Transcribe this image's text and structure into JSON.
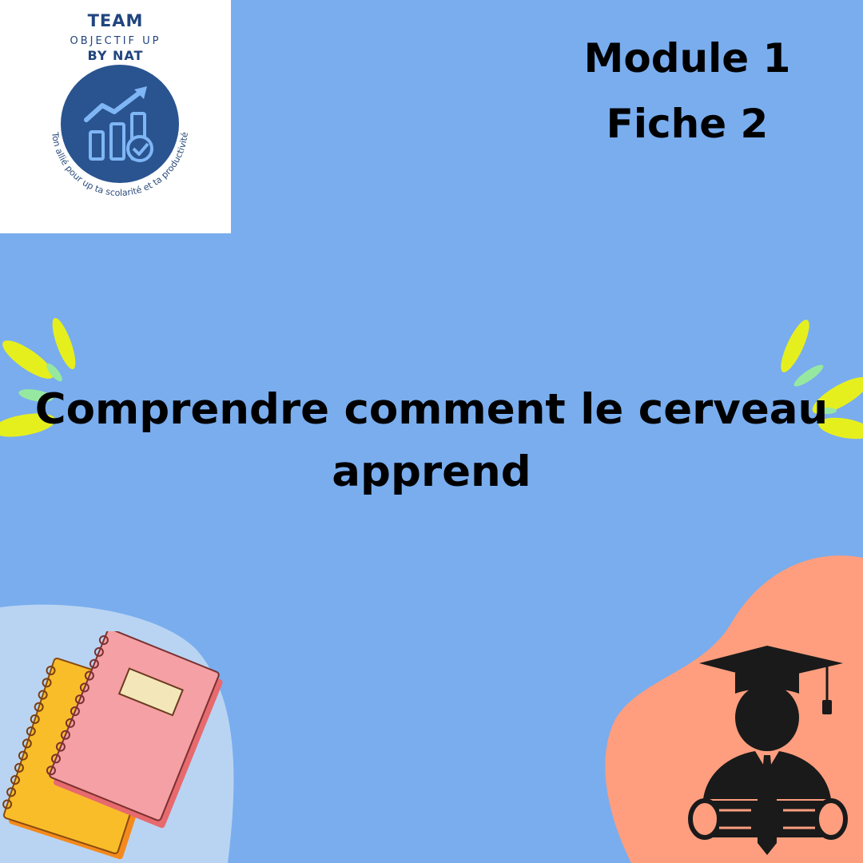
{
  "logo": {
    "line1": "TEAM",
    "line2": "OBJECTIF UP",
    "line3": "BY NAT",
    "tagline": "Ton allié pour up ta scolarité et ta productivité",
    "icon": "bar-chart-growth-check-icon",
    "brand_color": "#21457e"
  },
  "module": {
    "line1": "Module 1",
    "line2": "Fiche 2"
  },
  "title": {
    "line1": "Comprendre comment le cerveau",
    "line2": "apprend"
  },
  "illustrations": {
    "left": "notebooks-illustration",
    "right": "graduate-with-diploma-illustration",
    "accents": "yellow-green-sparkle-accents"
  },
  "colors": {
    "background": "#79adee",
    "blob_left": "#b9d4f2",
    "blob_right": "#fe9e7e",
    "accent_yellow": "#e6ef1e",
    "accent_green": "#96e8a0",
    "notebook_pink": "#f5a0a4",
    "notebook_yellow": "#f9bd2a"
  }
}
